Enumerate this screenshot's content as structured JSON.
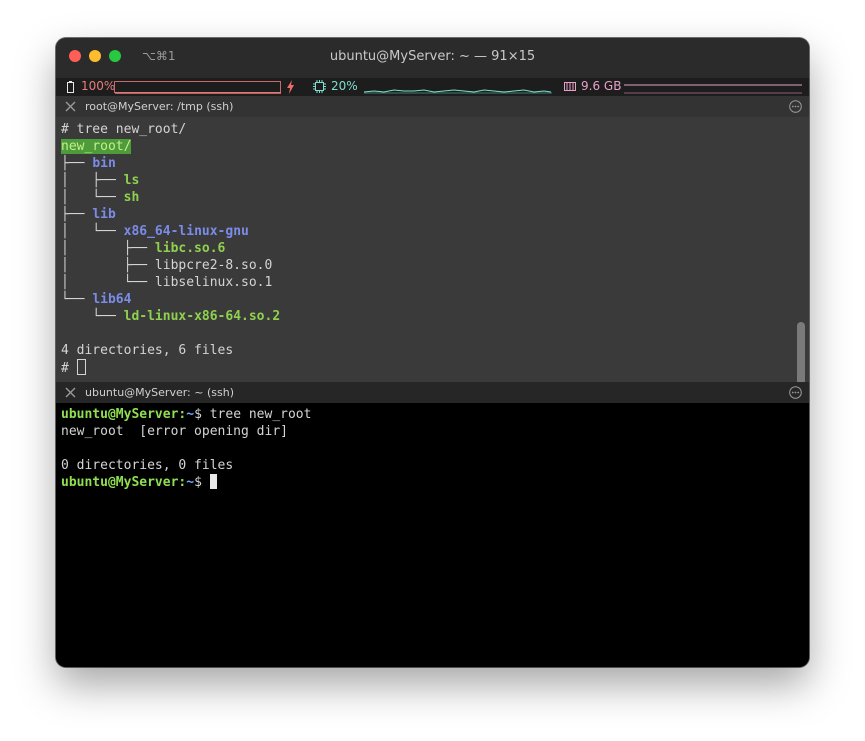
{
  "window": {
    "shortcut": "⌥⌘1",
    "title": "ubuntu@MyServer: ~ — 91×15"
  },
  "status": {
    "battery": "100%",
    "cpu": "20%",
    "memory": "9.6 GB",
    "battery_level": 1.0,
    "colors": {
      "battery": "#e87d7d",
      "cpu": "#7ee0cf",
      "memory": "#e8a0c8"
    }
  },
  "pane1": {
    "title": "root@MyServer: /tmp (ssh)",
    "lines": [
      [
        {
          "t": "# tree new_root/"
        }
      ],
      [
        {
          "t": "new_root/",
          "c": "hl"
        }
      ],
      [
        {
          "t": "├── "
        },
        {
          "t": "bin",
          "c": "dir"
        }
      ],
      [
        {
          "t": "│   ├── "
        },
        {
          "t": "ls",
          "c": "exe"
        }
      ],
      [
        {
          "t": "│   └── "
        },
        {
          "t": "sh",
          "c": "exe"
        }
      ],
      [
        {
          "t": "├── "
        },
        {
          "t": "lib",
          "c": "dir"
        }
      ],
      [
        {
          "t": "│   └── "
        },
        {
          "t": "x86_64-linux-gnu",
          "c": "dir"
        }
      ],
      [
        {
          "t": "│       ├── "
        },
        {
          "t": "libc.so.6",
          "c": "exe"
        }
      ],
      [
        {
          "t": "│       ├── libpcre2-8.so.0"
        }
      ],
      [
        {
          "t": "│       └── libselinux.so.1"
        }
      ],
      [
        {
          "t": "└── "
        },
        {
          "t": "lib64",
          "c": "dir"
        }
      ],
      [
        {
          "t": "    └── "
        },
        {
          "t": "ld-linux-x86-64.so.2",
          "c": "exe"
        }
      ],
      [
        {
          "t": ""
        }
      ],
      [
        {
          "t": "4 directories, 6 files"
        }
      ],
      [
        {
          "t": "# "
        },
        {
          "cursor": "hollow"
        }
      ]
    ]
  },
  "pane2": {
    "title": "ubuntu@MyServer: ~ (ssh)",
    "lines": [
      [
        {
          "t": "ubuntu@MyServer:",
          "c": "prompt"
        },
        {
          "t": "~",
          "c": "tilde"
        },
        {
          "t": "$ tree new_root"
        }
      ],
      [
        {
          "t": "new_root  [error opening dir]"
        }
      ],
      [
        {
          "t": ""
        }
      ],
      [
        {
          "t": "0 directories, 0 files"
        }
      ],
      [
        {
          "t": "ubuntu@MyServer:",
          "c": "prompt"
        },
        {
          "t": "~",
          "c": "tilde"
        },
        {
          "t": "$ "
        },
        {
          "cursor": "block"
        }
      ]
    ]
  },
  "icons": {
    "close_tab": "close-icon",
    "pane_menu": "ellipsis-circle-icon",
    "battery": "battery-icon",
    "charging": "lightning-bolt-icon",
    "cpu": "cpu-chip-icon",
    "memory": "memory-chip-icon"
  }
}
